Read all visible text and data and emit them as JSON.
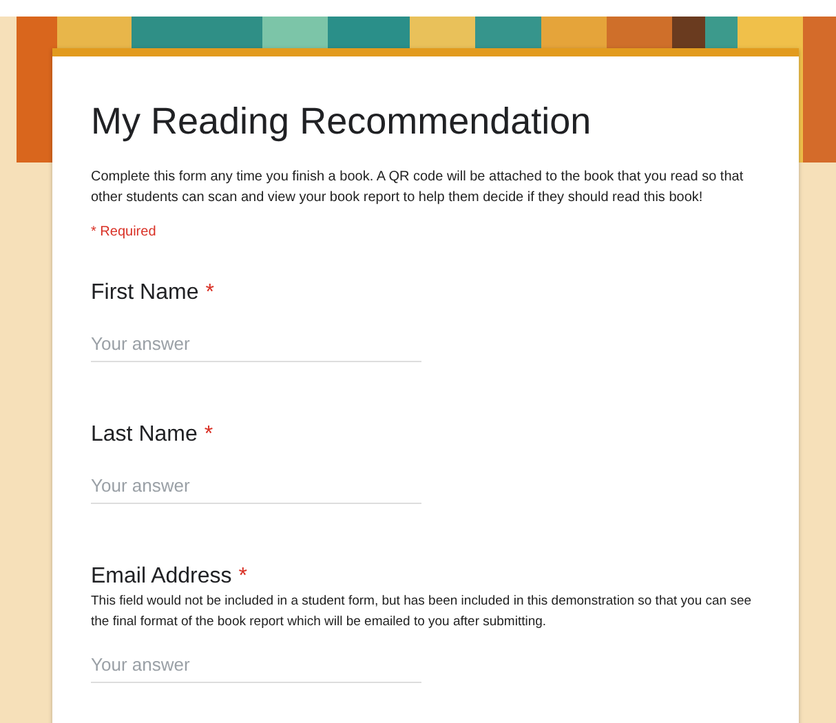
{
  "form": {
    "title": "My Reading Recommendation",
    "description": "Complete this form any time you finish a book. A QR code will be attached to the book that you read so that other students can scan and view your book report to help them decide if they should read this book!",
    "required_note": "* Required"
  },
  "questions": [
    {
      "label": "First Name",
      "required_mark": "*",
      "placeholder": "Your answer"
    },
    {
      "label": "Last Name",
      "required_mark": "*",
      "placeholder": "Your answer"
    },
    {
      "label": "Email Address",
      "required_mark": "*",
      "help": "This field would not be included in a student form, but has been included in this demonstration so that you can see the final format of the book report which will be emailed to you after submitting.",
      "placeholder": "Your answer"
    }
  ]
}
